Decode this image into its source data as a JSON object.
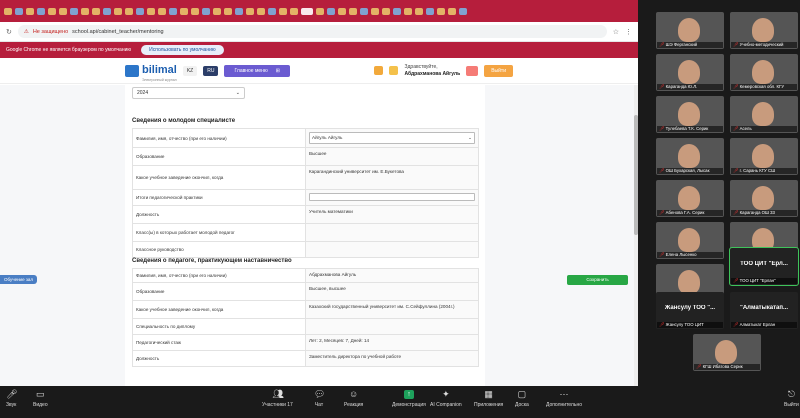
{
  "browser": {
    "not_secure_label": "Не защищено",
    "url": "school.api/cabinet_teacher/mentoring",
    "notice_text": "Google Chrome не является браузером по умолчанию",
    "notice_button": "Использовать по умолчанию"
  },
  "app": {
    "logo": "bilimal",
    "logo_tag": "Электронный журнал",
    "lang_kz": "KZ",
    "lang_ru": "RU",
    "menu_label": "Главное меню",
    "user_greeting": "Здравствуйте,",
    "user_name": "Абдрахманова Айгуль",
    "logout": "Выйти"
  },
  "form": {
    "year": "2024",
    "young_section_title": "Сведения о молодом специалисте",
    "young_rows": [
      {
        "label": "Фамилия, имя, отчество (при его наличии)",
        "value": "Айгуль Айгуль"
      },
      {
        "label": "Образование",
        "value": "Высшее"
      },
      {
        "label": "Какое учебное заведение окончил, когда",
        "value": "Карагандинский университет им. Е.Букетова"
      },
      {
        "label": "Итоги педагогической практики",
        "value": ""
      },
      {
        "label": "Должность",
        "value": "Учитель математики"
      },
      {
        "label": "Класс(ы) в которых работает молодой педагог",
        "value": ""
      },
      {
        "label": "Классное руководство",
        "value": ""
      }
    ],
    "mentor_section_title": "Сведения о педагоге, практикующем наставничество",
    "mentor_rows": [
      {
        "label": "Фамилия, имя, отчество (при его наличии)",
        "value": "Абдрахманова Айгуль"
      },
      {
        "label": "Образование",
        "value": "Высшее, высшее"
      },
      {
        "label": "Какое учебное заведение окончил, когда",
        "value": "Казахский государственный университет им. С.Сейфуллина (2004г.)"
      },
      {
        "label": "Специальность по диплому",
        "value": ""
      },
      {
        "label": "Педагогический стаж",
        "value": "Лет: 2, Месяцев: 7, Дней: 14"
      },
      {
        "label": "Должность",
        "value": "Заместитель директора по учебной работе"
      }
    ],
    "save_button": "Сохранить",
    "left_badge": "Обучение зал"
  },
  "gallery": [
    {
      "name": "Учебно-методический",
      "type": "video"
    },
    {
      "name": "ШЭ Ферганский",
      "type": "video"
    },
    {
      "name": "Караганда Ю.Л.",
      "type": "video"
    },
    {
      "name": "Кемеровская обл. КГУ",
      "type": "video"
    },
    {
      "name": "Тулебаева Т.К. Серик",
      "type": "video"
    },
    {
      "name": "Асель",
      "type": "video"
    },
    {
      "name": "ОШ Бухарская, Лысак",
      "type": "video"
    },
    {
      "name": "г. Сарань КГУ СШ",
      "type": "video"
    },
    {
      "name": "Абенова Г.А. Серик",
      "type": "video"
    },
    {
      "name": "Караганда ОШ 33",
      "type": "video"
    },
    {
      "name": "Елена Лысенко",
      "type": "video"
    },
    {
      "name": "г. Сарань, Чарусова",
      "type": "video"
    },
    {
      "name": "Елена Сарсенова",
      "type": "video"
    },
    {
      "name": "ТОО ЦИТ \"Ерлан\"",
      "type": "text",
      "big": "ТОО ЦИТ \"Ерл...",
      "active": true
    },
    {
      "name": "Жансулу ТОО ЦИТ",
      "type": "text",
      "big": "Жансулу ТОО \"..."
    },
    {
      "name": "Алматыкат Ерлан",
      "type": "text",
      "big": "\"Алматыкатап..."
    },
    {
      "name": "КГШ Ибатова Серик",
      "type": "video"
    }
  ],
  "toolbar": {
    "audio": "Звук",
    "video": "Видео",
    "participants": "Участники",
    "participants_count": "17",
    "chat": "Чат",
    "react": "Реакция",
    "share": "Демонстрация",
    "ai": "AI Companion",
    "apps": "Приложения",
    "whiteboard": "Доска",
    "more": "Дополнительно",
    "leave": "Выйти"
  },
  "colors": {
    "browser_red": "#b61e3c",
    "menu_purple": "#6b5bd1",
    "save_green": "#28a745",
    "share_green": "#1ea15c"
  }
}
